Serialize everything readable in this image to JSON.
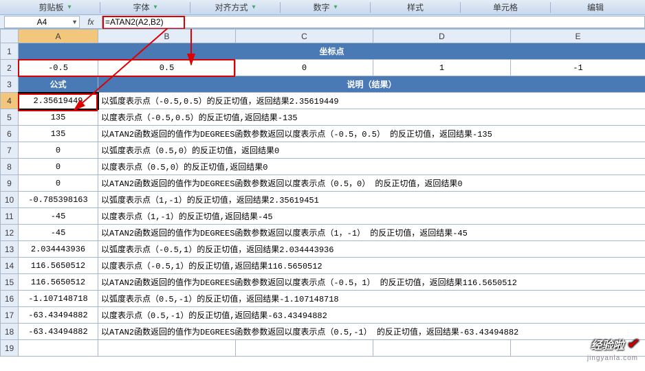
{
  "ribbon": {
    "tabs": [
      "剪贴板",
      "字体",
      "对齐方式",
      "数字",
      "样式",
      "单元格",
      "编辑"
    ]
  },
  "namebox": {
    "value": "A4"
  },
  "fx": {
    "label": "fx"
  },
  "formula": {
    "value": "=ATAN2(A2,B2)"
  },
  "columns": [
    "A",
    "B",
    "C",
    "D",
    "E"
  ],
  "header_row1": {
    "title": "坐标点"
  },
  "row2": {
    "A": "-0.5",
    "B": "0.5",
    "C": "0",
    "D": "1",
    "E": "-1"
  },
  "row3": {
    "A": "公式",
    "rest": "说明（结果）"
  },
  "rows": [
    {
      "n": "4",
      "A": "2.35619449",
      "desc": "以弧度表示点（-0.5,0.5）的反正切值，返回结果2.35619449"
    },
    {
      "n": "5",
      "A": "135",
      "desc": "以度表示点（-0.5,0.5）的反正切值,返回结果-135"
    },
    {
      "n": "6",
      "A": "135",
      "desc": "以ATAN2函数返回的值作为DEGREES函数参数返回以度表示点（-0.5，0.5） 的反正切值，返回结果-135"
    },
    {
      "n": "7",
      "A": "0",
      "desc": "以弧度表示点（0.5,0）的反正切值，返回结果0"
    },
    {
      "n": "8",
      "A": "0",
      "desc": "以度表示点（0.5,0）的反正切值,返回结果0"
    },
    {
      "n": "9",
      "A": "0",
      "desc": "以ATAN2函数返回的值作为DEGREES函数参数返回以度表示点（0.5，0） 的反正切值，返回结果0"
    },
    {
      "n": "10",
      "A": "-0.785398163",
      "desc": "以弧度表示点（1,-1）的反正切值，返回结果2.35619451"
    },
    {
      "n": "11",
      "A": "-45",
      "desc": "以度表示点（1,-1）的反正切值,返回结果-45"
    },
    {
      "n": "12",
      "A": "-45",
      "desc": "以ATAN2函数返回的值作为DEGREES函数参数返回以度表示点（1，-1） 的反正切值，返回结果-45"
    },
    {
      "n": "13",
      "A": "2.034443936",
      "desc": "以弧度表示点（-0.5,1）的反正切值，返回结果2.034443936"
    },
    {
      "n": "14",
      "A": "116.5650512",
      "desc": "以度表示点（-0.5,1）的反正切值,返回结果116.5650512"
    },
    {
      "n": "15",
      "A": "116.5650512",
      "desc": "以ATAN2函数返回的值作为DEGREES函数参数返回以度表示点（-0.5，1） 的反正切值，返回结果116.5650512"
    },
    {
      "n": "16",
      "A": "-1.107148718",
      "desc": "以弧度表示点（0.5,-1）的反正切值，返回结果-1.107148718"
    },
    {
      "n": "17",
      "A": "-63.43494882",
      "desc": "以度表示点（0.5,-1）的反正切值,返回结果-63.43494882"
    },
    {
      "n": "18",
      "A": "-63.43494882",
      "desc": "以ATAN2函数返回的值作为DEGREES函数参数返回以度表示点（0.5,-1） 的反正切值，返回结果-63.43494882"
    }
  ],
  "row19": {
    "n": "19"
  },
  "watermark": {
    "text": "经验啦",
    "sub": "jingyanla.com"
  }
}
